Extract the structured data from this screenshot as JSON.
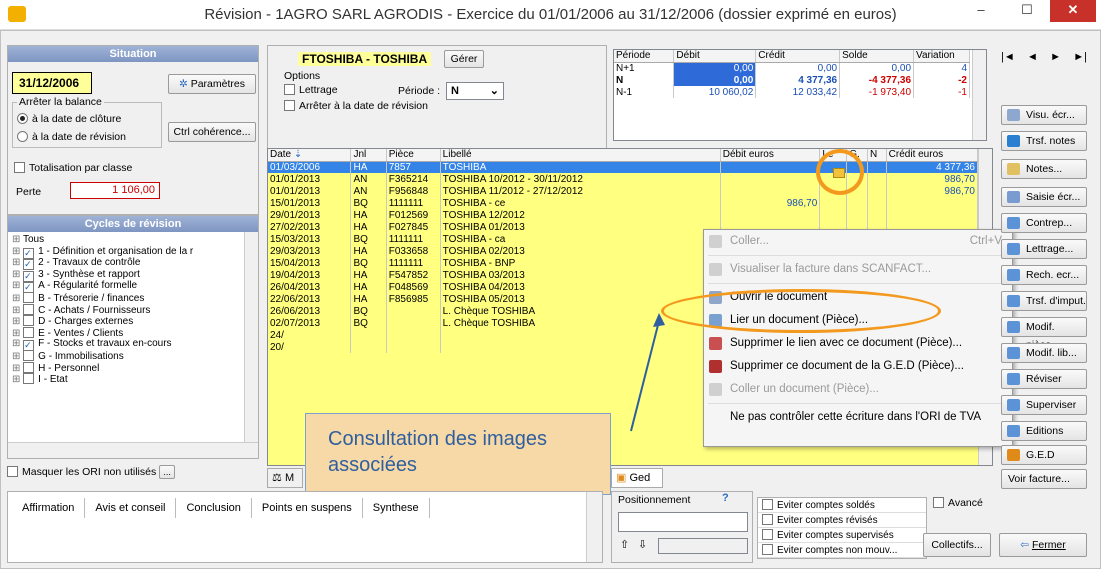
{
  "title": "Révision - 1AGRO SARL AGRODIS - Exercice du 01/01/2006 au 31/12/2006 (dossier exprimé en euros)",
  "situation": {
    "header": "Situation",
    "date": "31/12/2006",
    "params": "Paramètres",
    "arreter": "Arrêter la balance",
    "opt_cloture": "à la date de clôture",
    "opt_revision": "à la date de révision",
    "ctrl": "Ctrl cohérence...",
    "totalisation": "Totalisation par classe",
    "perte_label": "Perte",
    "perte_value": "1 106,00"
  },
  "cycles": {
    "header": "Cycles de révision",
    "items": [
      "Tous",
      "1 - Définition et organisation de la r",
      "2 - Travaux de contrôle",
      "3 - Synthèse et rapport",
      "A - Régularité formelle",
      "B - Trésorerie / finances",
      "C - Achats / Fournisseurs",
      "D - Charges externes",
      "E - Ventes / Clients",
      "F - Stocks et travaux en-cours",
      "G - Immobilisations",
      "H - Personnel",
      "I - Etat"
    ],
    "checked": [
      false,
      true,
      true,
      true,
      true,
      false,
      false,
      false,
      false,
      true,
      false,
      false,
      false
    ]
  },
  "masquer": "Masquer les ORI non utilisés",
  "account": {
    "title": "FTOSHIBA - TOSHIBA",
    "gerer": "Gérer",
    "options": "Options",
    "lettrage": "Lettrage",
    "periode_label": "Période :",
    "periode_value": "N",
    "arreter": "Arrêter à la date de révision"
  },
  "period_table": {
    "headers": [
      "Période",
      "Débit",
      "Crédit",
      "Solde",
      "Variation"
    ],
    "rows": [
      [
        "N+1",
        "0,00",
        "0,00",
        "0,00",
        "4"
      ],
      [
        "N",
        "0,00",
        "4 377,36",
        "-4 377,36",
        "-2"
      ],
      [
        "N-1",
        "10 060,02",
        "12 033,42",
        "-1 973,40",
        "-1"
      ]
    ]
  },
  "entries": {
    "headers": [
      "Date",
      "Jnl",
      "Pièce",
      "Libellé",
      "Débit euros",
      "Le",
      "G.",
      "N",
      "Crédit euros"
    ],
    "rows": [
      [
        "01/03/2006",
        "HA",
        "7857",
        "TOSHIBA",
        "",
        "",
        "",
        "",
        "4 377,36"
      ],
      [
        "01/01/2013",
        "AN",
        "F365214",
        "TOSHIBA 10/2012 - 30/11/2012",
        "",
        "",
        "",
        "",
        "986,70"
      ],
      [
        "01/01/2013",
        "AN",
        "F956848",
        "TOSHIBA 11/2012 - 27/12/2012",
        "",
        "",
        "",
        "",
        "986,70"
      ],
      [
        "15/01/2013",
        "BQ",
        "1111111",
        "TOSHIBA - ce",
        "986,70",
        "",
        "",
        "",
        ""
      ],
      [
        "29/01/2013",
        "HA",
        "F012569",
        "TOSHIBA 12/2012",
        "",
        "",
        "",
        "",
        ""
      ],
      [
        "27/02/2013",
        "HA",
        "F027845",
        "TOSHIBA 01/2013",
        "",
        "",
        "",
        "",
        ""
      ],
      [
        "15/03/2013",
        "BQ",
        "1111111",
        "TOSHIBA - ca",
        "",
        "",
        "",
        "",
        ""
      ],
      [
        "29/03/2013",
        "HA",
        "F033658",
        "TOSHIBA 02/2013",
        "",
        "",
        "",
        "",
        ""
      ],
      [
        "15/04/2013",
        "BQ",
        "1111111",
        "TOSHIBA - BNP",
        "",
        "",
        "",
        "",
        ""
      ],
      [
        "19/04/2013",
        "HA",
        "F547852",
        "TOSHIBA 03/2013",
        "",
        "",
        "",
        "",
        ""
      ],
      [
        "26/04/2013",
        "HA",
        "F048569",
        "TOSHIBA 04/2013",
        "",
        "",
        "",
        "",
        ""
      ],
      [
        "22/06/2013",
        "HA",
        "F856985",
        "TOSHIBA 05/2013",
        "",
        "",
        "",
        "",
        ""
      ],
      [
        "26/06/2013",
        "BQ",
        "",
        "L. Chèque TOSHIBA",
        "",
        "",
        "",
        "",
        ""
      ],
      [
        "02/07/2013",
        "BQ",
        "",
        "L. Chèque TOSHIBA",
        "",
        "",
        "",
        "",
        ""
      ],
      [
        "24/",
        "",
        "",
        "",
        "",
        "",
        "",
        "",
        ""
      ],
      [
        "20/",
        "",
        "",
        "",
        "",
        "",
        "",
        "",
        ""
      ]
    ]
  },
  "context_menu": {
    "items": [
      "Coller...",
      "Visualiser la facture dans SCANFACT...",
      "Ouvrir le document",
      "Lier un document (Pièce)...",
      "Supprimer le lien avec ce document (Pièce)...",
      "Supprimer ce document de la G.E.D (Pièce)...",
      "Coller un document (Pièce)...",
      "Ne pas contrôler cette écriture dans l'ORI de TVA"
    ],
    "shortcut": "Ctrl+V"
  },
  "callout": "Consultation des images associées",
  "side_buttons": [
    "Visu. écr...",
    "Trsf. notes",
    "Notes...",
    "Saisie écr...",
    "Contrep...",
    "Lettrage...",
    "Rech. ecr...",
    "Trsf. d'imput.",
    "Modif. pièce...",
    "Modif. lib...",
    "Réviser",
    "Superviser",
    "Editions",
    "G.E.D",
    "Voir facture..."
  ],
  "bottom_tabs": [
    "M",
    "Ged"
  ],
  "bottom_left_tabs": [
    "Affirmation",
    "Avis et conseil",
    "Conclusion",
    "Points en suspens",
    "Synthese"
  ],
  "positionnement": "Positionnement",
  "filters": [
    "Eviter comptes soldés",
    "Eviter comptes révisés",
    "Eviter comptes supervisés",
    "Eviter comptes non mouv..."
  ],
  "avance": "Avancé",
  "collectifs": "Collectifs...",
  "fermer": "Fermer",
  "nav": [
    "|◄",
    "◄",
    "►",
    "►|"
  ]
}
